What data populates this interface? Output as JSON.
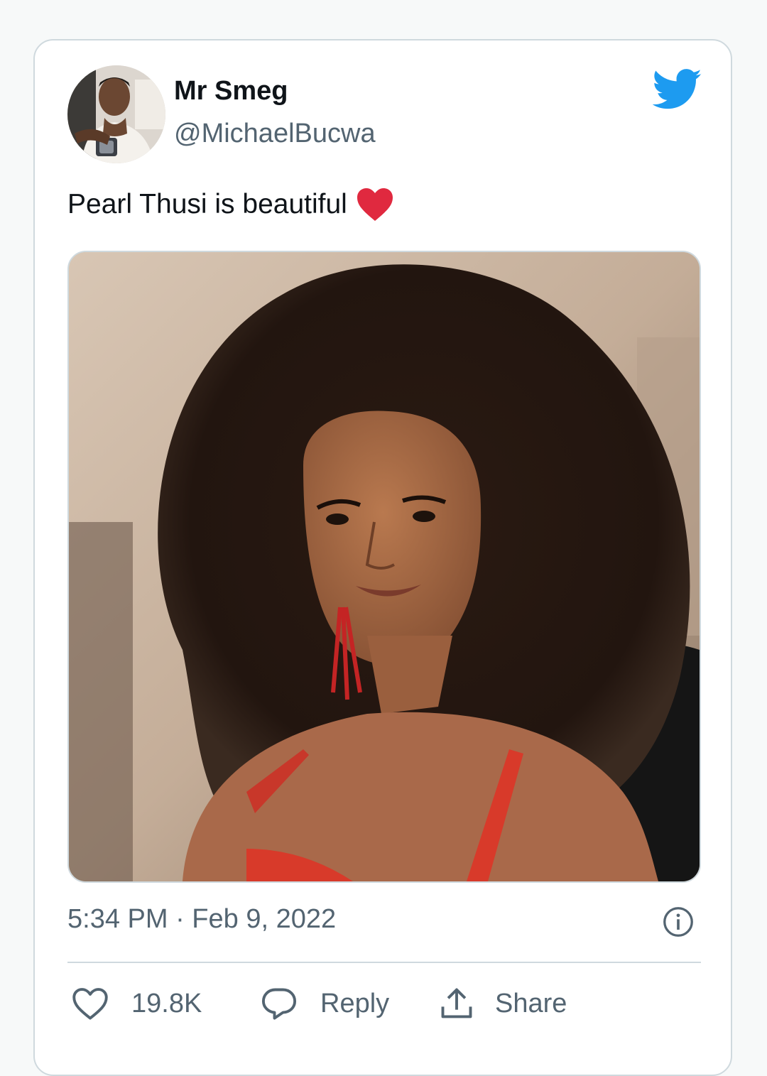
{
  "tweet": {
    "author": {
      "name": "Mr Smeg",
      "handle": "@MichaelBucwa"
    },
    "text": "Pearl Thusi is beautiful",
    "text_emoji": "red-heart-emoji",
    "timestamp": "5:34 PM · Feb 9, 2022",
    "likes": "19.8K",
    "reply_label": "Reply",
    "share_label": "Share"
  },
  "icons": {
    "brand": "twitter-bird-icon",
    "info": "info-icon",
    "like": "heart-icon",
    "reply": "speech-bubble-icon",
    "share": "share-upload-icon"
  },
  "colors": {
    "twitter_blue": "#1d9bf0",
    "text_primary": "#0f1419",
    "text_secondary": "#536471",
    "border": "#cfd9de",
    "heart_red": "#e0293f"
  }
}
